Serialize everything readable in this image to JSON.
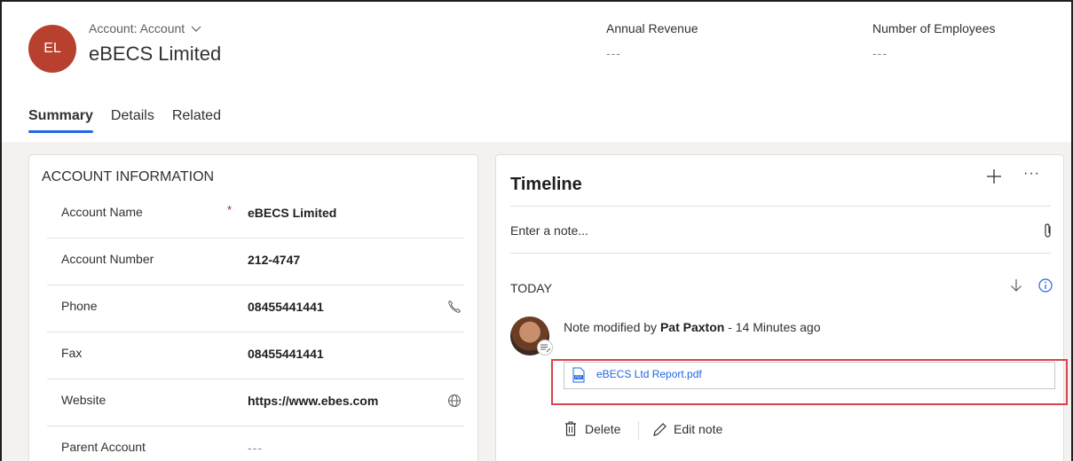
{
  "header": {
    "avatar_initials": "EL",
    "entity_type": "Account: Account",
    "record_name": "eBECS Limited",
    "fields": [
      {
        "label": "Annual Revenue",
        "value": "---"
      },
      {
        "label": "Number of Employees",
        "value": "---"
      }
    ]
  },
  "tabs": [
    {
      "label": "Summary",
      "active": true
    },
    {
      "label": "Details",
      "active": false
    },
    {
      "label": "Related",
      "active": false
    }
  ],
  "account_info": {
    "section_title": "ACCOUNT INFORMATION",
    "required_marker": "*",
    "fields": [
      {
        "label": "Account Name",
        "value": "eBECS Limited",
        "required": true
      },
      {
        "label": "Account Number",
        "value": "212-4747"
      },
      {
        "label": "Phone",
        "value": "08455441441",
        "icon": "phone-icon"
      },
      {
        "label": "Fax",
        "value": "08455441441"
      },
      {
        "label": "Website",
        "value": "https://www.ebes.com",
        "icon": "globe-icon"
      },
      {
        "label": "Parent Account",
        "value": "---"
      }
    ]
  },
  "timeline": {
    "title": "Timeline",
    "add_label": "+",
    "more_label": "···",
    "note_placeholder": "Enter a note...",
    "group_label": "TODAY",
    "post": {
      "prefix": "Note modified by",
      "author": "Pat Paxton",
      "suffix": "- 14 Minutes ago",
      "attachment": "eBECS Ltd Report.pdf",
      "delete_label": "Delete",
      "edit_label": "Edit note"
    }
  },
  "colors": {
    "accent": "#2266e3",
    "avatar_bg": "#b7412e",
    "required": "#a4262c",
    "highlight_frame": "#d9434b"
  }
}
